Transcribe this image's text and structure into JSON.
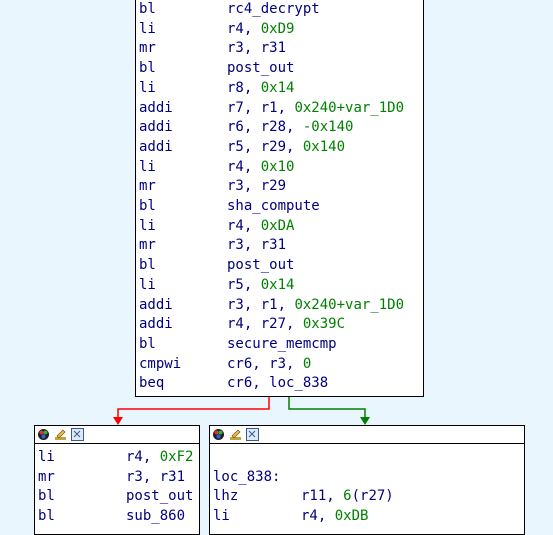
{
  "top_block": {
    "lines": [
      {
        "mnemonic": "bl",
        "operands": [
          {
            "t": "rc4_decrypt",
            "c": "ref"
          }
        ]
      },
      {
        "mnemonic": "li",
        "operands": [
          {
            "t": "r4, ",
            "c": "reg"
          },
          {
            "t": "0xD9",
            "c": "num"
          }
        ]
      },
      {
        "mnemonic": "mr",
        "operands": [
          {
            "t": "r3, r31",
            "c": "reg"
          }
        ]
      },
      {
        "mnemonic": "bl",
        "operands": [
          {
            "t": "post_out",
            "c": "ref"
          }
        ]
      },
      {
        "mnemonic": "li",
        "operands": [
          {
            "t": "r8, ",
            "c": "reg"
          },
          {
            "t": "0x14",
            "c": "num"
          }
        ]
      },
      {
        "mnemonic": "addi",
        "operands": [
          {
            "t": "r7, r1, ",
            "c": "reg"
          },
          {
            "t": "0x240+var_1D0",
            "c": "num"
          }
        ]
      },
      {
        "mnemonic": "addi",
        "operands": [
          {
            "t": "r6, r28, ",
            "c": "reg"
          },
          {
            "t": "-0x140",
            "c": "num"
          }
        ]
      },
      {
        "mnemonic": "addi",
        "operands": [
          {
            "t": "r5, r29, ",
            "c": "reg"
          },
          {
            "t": "0x140",
            "c": "num"
          }
        ]
      },
      {
        "mnemonic": "li",
        "operands": [
          {
            "t": "r4, ",
            "c": "reg"
          },
          {
            "t": "0x10",
            "c": "num"
          }
        ]
      },
      {
        "mnemonic": "mr",
        "operands": [
          {
            "t": "r3, r29",
            "c": "reg"
          }
        ]
      },
      {
        "mnemonic": "bl",
        "operands": [
          {
            "t": "sha_compute",
            "c": "ref"
          }
        ]
      },
      {
        "mnemonic": "li",
        "operands": [
          {
            "t": "r4, ",
            "c": "reg"
          },
          {
            "t": "0xDA",
            "c": "num"
          }
        ]
      },
      {
        "mnemonic": "mr",
        "operands": [
          {
            "t": "r3, r31",
            "c": "reg"
          }
        ]
      },
      {
        "mnemonic": "bl",
        "operands": [
          {
            "t": "post_out",
            "c": "ref"
          }
        ]
      },
      {
        "mnemonic": "li",
        "operands": [
          {
            "t": "r5, ",
            "c": "reg"
          },
          {
            "t": "0x14",
            "c": "num"
          }
        ]
      },
      {
        "mnemonic": "addi",
        "operands": [
          {
            "t": "r3, r1, ",
            "c": "reg"
          },
          {
            "t": "0x240+var_1D0",
            "c": "num"
          }
        ]
      },
      {
        "mnemonic": "addi",
        "operands": [
          {
            "t": "r4, r27, ",
            "c": "reg"
          },
          {
            "t": "0x39C",
            "c": "num"
          }
        ]
      },
      {
        "mnemonic": "bl",
        "operands": [
          {
            "t": "secure_memcmp",
            "c": "ref"
          }
        ]
      },
      {
        "mnemonic": "cmpwi",
        "operands": [
          {
            "t": "cr6, r3, ",
            "c": "reg"
          },
          {
            "t": "0",
            "c": "num"
          }
        ]
      },
      {
        "mnemonic": "beq",
        "operands": [
          {
            "t": "cr6, loc_838",
            "c": "ref"
          }
        ]
      }
    ]
  },
  "left_block": {
    "lines": [
      {
        "mnemonic": "li",
        "operands": [
          {
            "t": "r4, ",
            "c": "reg"
          },
          {
            "t": "0xF2",
            "c": "num"
          }
        ]
      },
      {
        "mnemonic": "mr",
        "operands": [
          {
            "t": "r3, r31",
            "c": "reg"
          }
        ]
      },
      {
        "mnemonic": "bl",
        "operands": [
          {
            "t": "post_out",
            "c": "ref"
          }
        ]
      },
      {
        "mnemonic": "bl",
        "operands": [
          {
            "t": "sub_860",
            "c": "ref"
          }
        ]
      }
    ]
  },
  "right_block": {
    "label": "loc_838:",
    "lines": [
      {
        "mnemonic": "lhz",
        "operands": [
          {
            "t": "r11, ",
            "c": "reg"
          },
          {
            "t": "6",
            "c": "num"
          },
          {
            "t": "(r27)",
            "c": "reg"
          }
        ]
      },
      {
        "mnemonic": "li",
        "operands": [
          {
            "t": "r4, ",
            "c": "reg"
          },
          {
            "t": "0xDB",
            "c": "num"
          }
        ]
      }
    ]
  },
  "node_icons": [
    "graph-color-icon",
    "rename-pencil-icon",
    "collapse-node-icon"
  ],
  "colors": {
    "background": "#eaf6fe",
    "edge_false": "#ff0000",
    "edge_true": "#008000",
    "mnemonic": "#000080",
    "number": "#008000"
  }
}
